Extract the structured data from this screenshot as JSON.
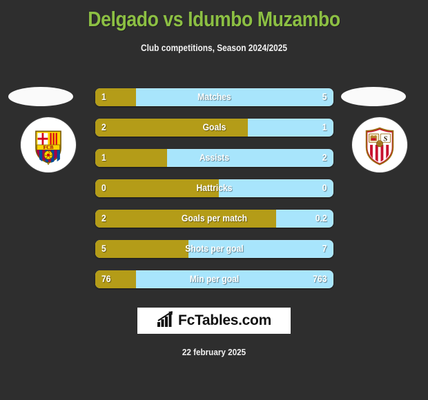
{
  "header": {
    "title": "Delgado vs Idumbo Muzambo",
    "subtitle": "Club competitions, Season 2024/2025",
    "title_color": "#8cbf43"
  },
  "teams": {
    "home": {
      "name": "FC Barcelona",
      "crest_text": "FCB"
    },
    "away": {
      "name": "Sevilla FC",
      "crest_text": ""
    }
  },
  "colors": {
    "background": "#2e2e2e",
    "home_bar": "#b49c18",
    "away_bar": "#a8e5fc",
    "text": "#ffffff"
  },
  "chart_data": {
    "type": "bar",
    "title": "Delgado vs Idumbo Muzambo",
    "subtitle": "Club competitions, Season 2024/2025",
    "orientation": "horizontal-diverging",
    "series": [
      {
        "name": "Delgado",
        "side": "left",
        "color": "#b49c18"
      },
      {
        "name": "Idumbo Muzambo",
        "side": "right",
        "color": "#a8e5fc"
      }
    ],
    "categories": [
      "Matches",
      "Goals",
      "Assists",
      "Hattricks",
      "Goals per match",
      "Shots per goal",
      "Min per goal"
    ],
    "rows": [
      {
        "label": "Matches",
        "home": "1",
        "away": "5",
        "home_pct": 17
      },
      {
        "label": "Goals",
        "home": "2",
        "away": "1",
        "home_pct": 64
      },
      {
        "label": "Assists",
        "home": "1",
        "away": "2",
        "home_pct": 30
      },
      {
        "label": "Hattricks",
        "home": "0",
        "away": "0",
        "home_pct": 52
      },
      {
        "label": "Goals per match",
        "home": "2",
        "away": "0.2",
        "home_pct": 76
      },
      {
        "label": "Shots per goal",
        "home": "5",
        "away": "7",
        "home_pct": 39
      },
      {
        "label": "Min per goal",
        "home": "76",
        "away": "763",
        "home_pct": 17
      }
    ]
  },
  "footer": {
    "logo_text": "FcTables.com",
    "logo_icon": "bar-chart-icon",
    "date": "22 february 2025"
  }
}
